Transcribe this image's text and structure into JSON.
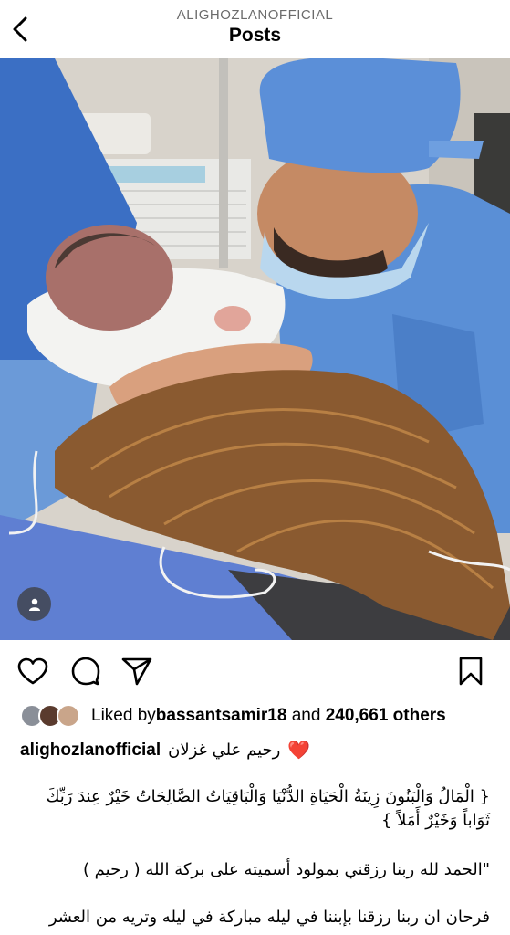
{
  "header": {
    "username": "ALIGHOZLANOFFICIAL",
    "title": "Posts"
  },
  "likes": {
    "prefix": "Liked by ",
    "user": "bassantsamir18",
    "middle": " and ",
    "count": "240,661 others"
  },
  "caption": {
    "username": "alighozlanofficial",
    "text": "رحيم علي غزلان",
    "emoji": "❤️",
    "verse": "{ الْمَالُ وَالْبَنُونَ زِينَةُ الْحَيَاةِ الدُّنْيَا وَالْبَاقِيَاتُ الصَّالِحَاتُ خَيْرٌ عِندَ رَبِّكَ ثَوَاباً وَخَيْرٌ أَمَلاً }",
    "paragraph1": "\"الحمد لله ربنا رزقني بمولود أسميته على بركة الله ( رحيم )",
    "paragraph2": "فرحان ان ربنا رزقنا بإبننا في ليله مباركة في ليله وتريه من العشر"
  },
  "icons": {
    "back": "chevron-left-icon",
    "tag": "user-tag-icon",
    "like": "heart-icon",
    "comment": "comment-icon",
    "share": "paper-plane-icon",
    "save": "bookmark-icon"
  }
}
